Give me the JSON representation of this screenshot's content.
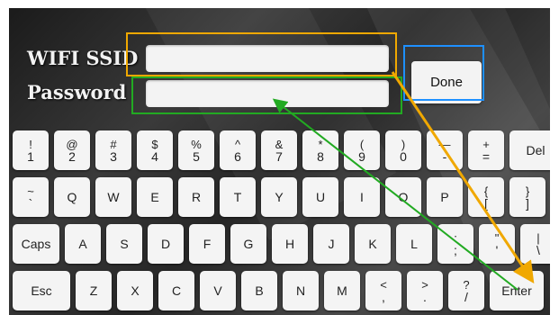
{
  "labels": {
    "ssid": "WIFI SSID",
    "password": "Password"
  },
  "fields": {
    "ssid_value": "",
    "password_value": ""
  },
  "done_label": "Done",
  "keyboard": {
    "row1": [
      {
        "top": "!",
        "bottom": "1"
      },
      {
        "top": "@",
        "bottom": "2"
      },
      {
        "top": "#",
        "bottom": "3"
      },
      {
        "top": "$",
        "bottom": "4"
      },
      {
        "top": "%",
        "bottom": "5"
      },
      {
        "top": "^",
        "bottom": "6"
      },
      {
        "top": "&",
        "bottom": "7"
      },
      {
        "top": "*",
        "bottom": "8"
      },
      {
        "top": "(",
        "bottom": "9"
      },
      {
        "top": ")",
        "bottom": "0"
      },
      {
        "top": "—",
        "bottom": "-"
      },
      {
        "top": "+",
        "bottom": "="
      },
      {
        "label": "Del"
      }
    ],
    "row2": [
      {
        "top": "~",
        "bottom": "`"
      },
      {
        "label": "Q"
      },
      {
        "label": "W"
      },
      {
        "label": "E"
      },
      {
        "label": "R"
      },
      {
        "label": "T"
      },
      {
        "label": "Y"
      },
      {
        "label": "U"
      },
      {
        "label": "I"
      },
      {
        "label": "O"
      },
      {
        "label": "P"
      },
      {
        "top": "{",
        "bottom": "["
      },
      {
        "top": "}",
        "bottom": "]"
      }
    ],
    "row3": [
      {
        "label": "Caps"
      },
      {
        "label": "A"
      },
      {
        "label": "S"
      },
      {
        "label": "D"
      },
      {
        "label": "F"
      },
      {
        "label": "G"
      },
      {
        "label": "H"
      },
      {
        "label": "J"
      },
      {
        "label": "K"
      },
      {
        "label": "L"
      },
      {
        "top": ":",
        "bottom": ";"
      },
      {
        "top": "\"",
        "bottom": "'"
      },
      {
        "top": "|",
        "bottom": "\\"
      }
    ],
    "row4": [
      {
        "label": "Esc"
      },
      {
        "label": "Z"
      },
      {
        "label": "X"
      },
      {
        "label": "C"
      },
      {
        "label": "V"
      },
      {
        "label": "B"
      },
      {
        "label": "N"
      },
      {
        "label": "M"
      },
      {
        "top": "<",
        "bottom": ","
      },
      {
        "top": ">",
        "bottom": "."
      },
      {
        "top": "?",
        "bottom": "/"
      },
      {
        "label": "Enter"
      }
    ]
  },
  "annotation_colors": {
    "orange": "#f0a800",
    "blue": "#1e90ff",
    "green": "#22aa22"
  }
}
